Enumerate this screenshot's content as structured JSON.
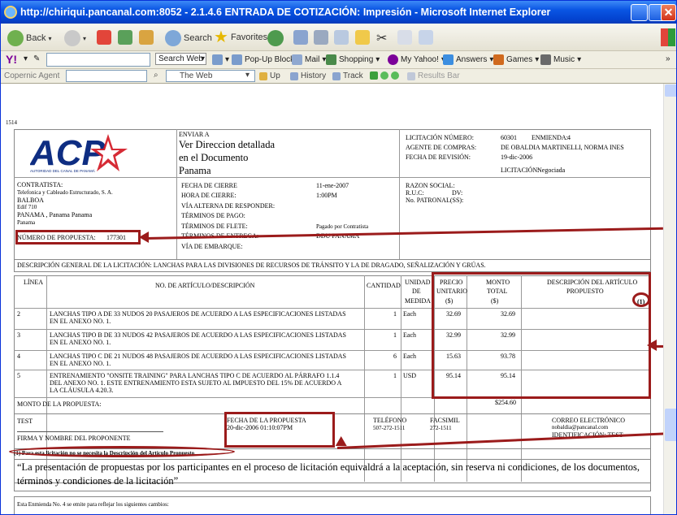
{
  "window": {
    "title": "http://chiriqui.pancanal.com:8052 - 2.1.4.6 ENTRADA DE COTIZACIÓN: Impresión - Microsoft Internet Explorer",
    "close_label": "✕"
  },
  "toolbar": {
    "back": "Back",
    "search": "Search",
    "favorites": "Favorites"
  },
  "yahoo_bar": {
    "search_web": "Search Web",
    "popup_blocker": "Pop-Up Blocker",
    "mail": "Mail",
    "shopping": "Shopping",
    "my_yahoo": "My Yahoo!",
    "answers": "Answers",
    "games": "Games",
    "music": "Music"
  },
  "copernic_bar": {
    "label": "Copernic Agent",
    "web_option": "The Web",
    "up": "Up",
    "history": "History",
    "track": "Track",
    "results_bar": "Results Bar"
  },
  "document": {
    "page_id": "1514",
    "logo_text": "ACP",
    "logo_sub": "AUTORIDAD DEL CANAL DE PANAMÁ",
    "enviar_label": "ENVIAR A",
    "enviar_lines": [
      "Ver Direccion detallada",
      "en el Documento",
      "Panama"
    ],
    "licitacion_numero_label": "LICITACIÓN NÚMERO:",
    "licitacion_numero": "60301",
    "enmienda_label": "ENMIENDA:",
    "enmienda": "4",
    "agente_label": "AGENTE DE COMPRAS:",
    "agente": "DE OBALDIA MARTINELLI, NORMA INES",
    "fecha_revision_label": "FECHA DE REVISIÓN:",
    "fecha_revision": "19-dic-2006",
    "licitacion_label": "LICITACIÓN:",
    "licitacion_tipo": "Negociada",
    "contratista_label": "CONTRATISTA:",
    "contratista_lines": [
      "Telefonica y Cableado Estructurado, S. A.",
      "BALBOA",
      "Edif 710",
      "PANAMA ,  Panama Panama",
      "Panama"
    ],
    "numero_propuesta_label": "NÚMERO DE PROPUESTA:",
    "numero_propuesta": "177301",
    "fecha_cierre_label": "FECHA DE CIERRE",
    "fecha_cierre": "11-ene-2007",
    "hora_cierre_label": "HORA DE CIERRE:",
    "hora_cierre": "1:00PM",
    "via_alterna_label": "VÍA ALTERNA DE RESPONDER:",
    "terminos_pago_label": "TÉRMINOS DE PAGO:",
    "terminos_flete_label": "TÉRMINOS DE FLETE:",
    "terminos_flete": "Pagado por Contratista",
    "terminos_entrega_label": "TÉRMINOS DE ENTREGA:",
    "terminos_entrega": "DDU PANAMA",
    "via_embarque_label": "VÍA DE EMBARQUE:",
    "razon_social_label": "RAZON SOCIAL:",
    "ruc_label": "R.U.C:",
    "dv_label": "DV:",
    "patronal_label": "No. PATRONAL(SS):",
    "descripcion_general": "DESCRIPCIÓN GENERAL DE LA LICITACIÓN: LANCHAS PARA LAS DIVISIONES DE RECURSOS DE TRÁNSITO Y LA DE DRAGADO, SEÑALIZACIÓN Y GRÚAS."
  },
  "table": {
    "headers": {
      "linea": "LÍNEA",
      "articulo": "NO. DE ARTÍCULO/DESCRIPCIÓN",
      "cantidad": "CANTIDAD",
      "unidad": [
        "UNIDAD",
        "DE",
        "MEDIDA"
      ],
      "precio": [
        "PRECIO",
        "UNITARIO",
        "($)"
      ],
      "monto": [
        "MONTO",
        "TOTAL",
        "($)"
      ],
      "descripcion": [
        "DESCRIPCIÓN DEL ARTÍCULO",
        "PROPUESTO"
      ],
      "nota": "(1)"
    },
    "rows": [
      {
        "linea": "2",
        "desc": [
          "LANCHAS TIPO A DE 33 NUDOS 20 PASAJEROS DE ACUERDO A LAS ESPECIFICACIONES LISTADAS",
          "EN EL ANEXO NO. 1."
        ],
        "cantidad": "1",
        "unidad": "Each",
        "precio": "32.69",
        "monto": "32.69"
      },
      {
        "linea": "3",
        "desc": [
          "LANCHAS TIPO B DE 33 NUDOS 42 PASAJEROS DE ACUERDO A LAS ESPECIFICACIONES LISTADAS",
          "EN EL ANEXO NO. 1."
        ],
        "cantidad": "1",
        "unidad": "Each",
        "precio": "32.99",
        "monto": "32.99"
      },
      {
        "linea": "4",
        "desc": [
          "LANCHAS TIPO C DE 21 NUDOS 48 PASAJEROS DE ACUERDO A LAS ESPECIFICACIONES LISTADAS",
          "EN EL ANEXO NO. 1."
        ],
        "cantidad": "6",
        "unidad": "Each",
        "precio": "15.63",
        "monto": "93.78"
      },
      {
        "linea": "5",
        "desc": [
          "ENTRENAMIENTO \"ONSITE TRAINING\" PARA LANCHAS TIPO C DE ACUERDO AL PÁRRAFO 1.1.4",
          "DEL ANEXO NO. 1. ESTE ENTRENAMIENTO ESTA SUJETO AL IMPUESTO DEL 15% DE ACUERDO A",
          "LA CLÁUSULA 4.20.3."
        ],
        "cantidad": "1",
        "unidad": "USD",
        "precio": "95.14",
        "monto": "95.14"
      }
    ],
    "monto_label": "MONTO DE LA PROPUESTA:",
    "monto_total": "$254.60"
  },
  "footer": {
    "nombre": "TEST",
    "firma_label": "FIRMA Y NOMBRE DEL PROPONENTE",
    "fecha_propuesta_label": "FECHA DE LA PROPUESTA",
    "fecha_propuesta": "20-dic-2006 01:10:07PM",
    "telefono_label": "TELÉFONO",
    "telefono": "507-272-1511",
    "facsimil_label": "FACSIMIL",
    "facsimil": "272-1511",
    "correo_label": "CORREO ELECTRÓNICO",
    "correo": "nobaldia@pancanal.com",
    "identificacion": "IDENTIFICACIÓN: TEST",
    "nota": "(1) Para esta licitación no se necesita la Descripción del Artículo Propuesto",
    "aceptacion": "“La presentación de propuestas por los participantes en el proceso de licitación equivaldrá a la aceptación, sin reserva ni condiciones, de los documentos,",
    "aceptacion2": "términos y condiciones de la licitación”",
    "enmienda_text": "Esta Enmienda No. 4 se emite para reflejar los siguientes cambios:"
  },
  "colors": {
    "highlight": "#9b1b1b",
    "titlebar": "#0a55e3",
    "logo_blue": "#0e2d82",
    "logo_red": "#d4202a"
  }
}
